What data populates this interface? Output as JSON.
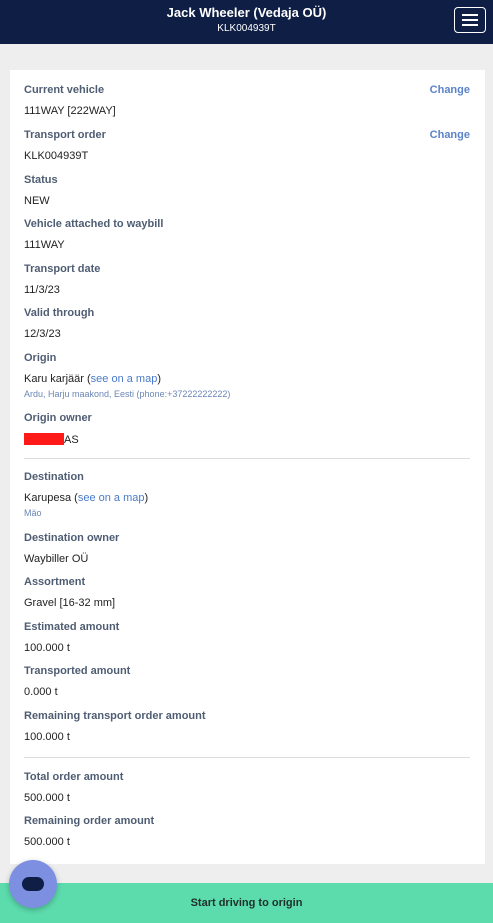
{
  "header": {
    "title": "Jack Wheeler (Vedaja OÜ)",
    "subtitle": "KLK004939T"
  },
  "fields": {
    "current_vehicle": {
      "label": "Current vehicle",
      "value": "111WAY [222WAY]",
      "action": "Change"
    },
    "transport_order": {
      "label": "Transport order",
      "value": "KLK004939T",
      "action": "Change"
    },
    "status": {
      "label": "Status",
      "value": "NEW"
    },
    "vehicle_attached": {
      "label": "Vehicle attached to waybill",
      "value": "111WAY"
    },
    "transport_date": {
      "label": "Transport date",
      "value": "11/3/23"
    },
    "valid_through": {
      "label": "Valid through",
      "value": "12/3/23"
    },
    "origin": {
      "label": "Origin",
      "name": "Karu karjäär",
      "open_paren": "(",
      "map_link": "see on a map",
      "close_paren": ")",
      "address": "Ardu, Harju maakond, Eesti (phone:+37222222222)"
    },
    "origin_owner": {
      "label": "Origin owner",
      "value_suffix": "AS"
    },
    "destination": {
      "label": "Destination",
      "name": "Karupesa",
      "open_paren": "(",
      "map_link": "see on a map",
      "close_paren": ")",
      "address": "Mäo"
    },
    "destination_owner": {
      "label": "Destination owner",
      "value": "Waybiller OÜ"
    },
    "assortment": {
      "label": "Assortment",
      "value": "Gravel [16-32 mm]"
    },
    "estimated_amount": {
      "label": "Estimated amount",
      "value": "100.000 t"
    },
    "transported_amount": {
      "label": "Transported amount",
      "value": "0.000 t"
    },
    "remaining_transport": {
      "label": "Remaining transport order amount",
      "value": "100.000 t"
    },
    "total_order": {
      "label": "Total order amount",
      "value": "500.000 t"
    },
    "remaining_order": {
      "label": "Remaining order amount",
      "value": "500.000 t"
    }
  },
  "footer": {
    "primary_button": "Start driving to origin"
  },
  "colors": {
    "header_bg": "#0e1e44",
    "accent_link": "#5b83c9",
    "primary_button_bg": "#5cdcad",
    "chat_button_bg": "#7c8fe0",
    "redaction": "#ff1a1a"
  },
  "icons": {
    "menu": "hamburger-menu-icon",
    "chat": "chat-bubble-icon"
  }
}
